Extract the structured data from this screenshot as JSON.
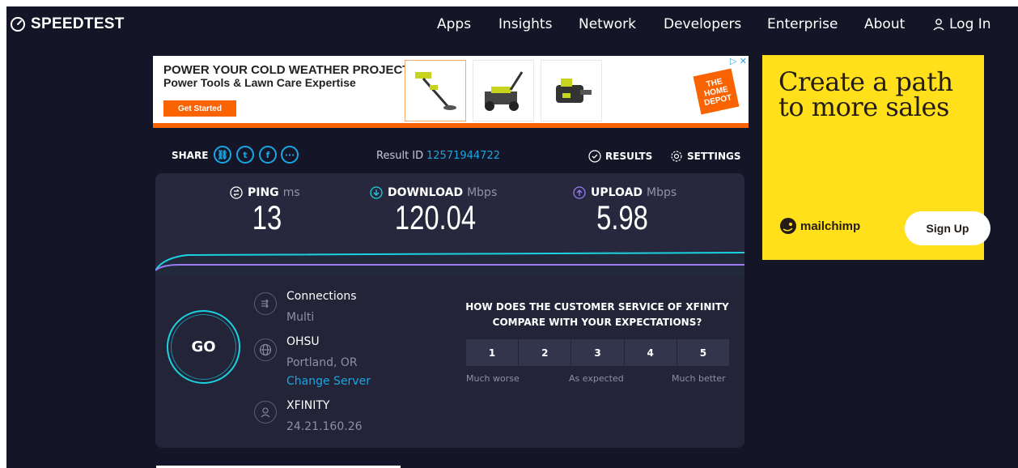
{
  "nav": {
    "brand": "SPEEDTEST",
    "links": [
      "Apps",
      "Insights",
      "Network",
      "Developers",
      "Enterprise",
      "About"
    ],
    "login": "Log In"
  },
  "ad_top": {
    "headline": "POWER YOUR COLD WEATHER PROJECTS",
    "subhead": "Power Tools & Lawn Care Expertise",
    "button": "Get Started",
    "logo_text": "THE HOME DEPOT"
  },
  "ad_side": {
    "headline": "Create a path to more sales",
    "brand": "mailchimp",
    "button": "Sign Up"
  },
  "share": {
    "label": "SHARE",
    "icons": [
      "link-icon",
      "twitter-icon",
      "facebook-icon",
      "more-icon"
    ]
  },
  "result": {
    "label": "Result ID",
    "id": "12571944722",
    "results_label": "RESULTS",
    "settings_label": "SETTINGS"
  },
  "metrics": {
    "ping": {
      "label": "PING",
      "unit": "ms",
      "value": "13"
    },
    "download": {
      "label": "DOWNLOAD",
      "unit": "Mbps",
      "value": "120.04"
    },
    "upload": {
      "label": "UPLOAD",
      "unit": "Mbps",
      "value": "5.98"
    }
  },
  "go_label": "GO",
  "connection": {
    "connections_title": "Connections",
    "connections_value": "Multi",
    "server_name": "OHSU",
    "server_location": "Portland, OR",
    "change_server": "Change Server",
    "isp": "XFINITY",
    "ip": "24.21.160.26"
  },
  "survey": {
    "question": "HOW DOES THE CUSTOMER SERVICE OF XFINITY COMPARE WITH YOUR EXPECTATIONS?",
    "options": [
      "1",
      "2",
      "3",
      "4",
      "5"
    ],
    "low_label": "Much worse",
    "mid_label": "As expected",
    "high_label": "Much better"
  },
  "colors": {
    "background": "#141526",
    "panel": "#27283d",
    "accent_cyan": "#1bd2e0",
    "accent_purple": "#9b7bf5",
    "link_blue": "#1aa6e4",
    "ad_orange": "#f96302",
    "mailchimp_yellow": "#ffe01b"
  }
}
